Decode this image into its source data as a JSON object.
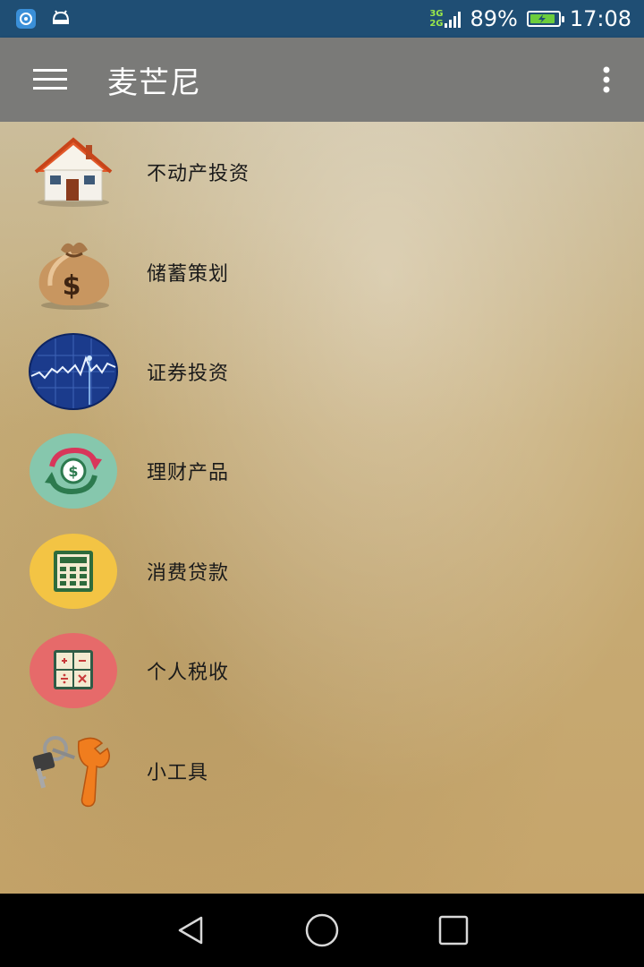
{
  "status_bar": {
    "network_top": "3G",
    "network_bottom": "2G",
    "battery": "89%",
    "battery_level": 0.89,
    "time": "17:08"
  },
  "app_bar": {
    "title": "麦芒尼",
    "menu_icon": "hamburger-menu-icon",
    "overflow_icon": "more-vertical-icon"
  },
  "menu": {
    "items": [
      {
        "label": "不动产投资",
        "icon": "house-icon"
      },
      {
        "label": "储蓄策划",
        "icon": "money-bag-icon"
      },
      {
        "label": "证券投资",
        "icon": "stock-chart-icon"
      },
      {
        "label": "理财产品",
        "icon": "money-cycle-icon"
      },
      {
        "label": "消费贷款",
        "icon": "calculator-icon"
      },
      {
        "label": "个人税收",
        "icon": "math-operators-icon"
      },
      {
        "label": "小工具",
        "icon": "keys-wrench-icon"
      }
    ]
  },
  "nav_bar": {
    "back_icon": "back-triangle-icon",
    "home_icon": "home-circle-icon",
    "recents_icon": "recents-square-icon"
  },
  "colors": {
    "status_bar": "#1f4e74",
    "app_bar": "#7a7a78",
    "battery_fill": "#6ccd3c",
    "network_text": "#9be84a"
  }
}
